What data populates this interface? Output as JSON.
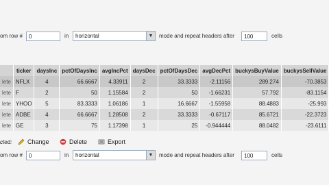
{
  "top_bar": {
    "from_row_label": "om row #",
    "from_row_value": "0",
    "in_label": "in",
    "orientation_value": "horizontal",
    "mode_label": "mode and repeat headers after",
    "repeat_value": "100",
    "cells_label": "cells"
  },
  "table": {
    "columns": [
      "ticker",
      "daysInc",
      "pctOfDaysInc",
      "avgIncPct",
      "daysDec",
      "pctOfDaysDec",
      "avgDecPct",
      "buckysBuyValue",
      "buckysSellValue"
    ],
    "rows": [
      {
        "del": "lete",
        "ticker": "NFLX",
        "daysInc": "4",
        "pctOfDaysInc": "66.6667",
        "avgIncPct": "4.33911",
        "daysDec": "2",
        "pctOfDaysDec": "33.3333",
        "avgDecPct": "-2.11156",
        "buy": "289.274",
        "sell": "-70.3853"
      },
      {
        "del": "lete",
        "ticker": "F",
        "daysInc": "2",
        "pctOfDaysInc": "50",
        "avgIncPct": "1.15584",
        "daysDec": "2",
        "pctOfDaysDec": "50",
        "avgDecPct": "-1.66231",
        "buy": "57.792",
        "sell": "-83.1154"
      },
      {
        "del": "lete",
        "ticker": "YHOO",
        "daysInc": "5",
        "pctOfDaysInc": "83.3333",
        "avgIncPct": "1.06186",
        "daysDec": "1",
        "pctOfDaysDec": "16.6667",
        "avgDecPct": "-1.55958",
        "buy": "88.4883",
        "sell": "-25.993"
      },
      {
        "del": "lete",
        "ticker": "ADBE",
        "daysInc": "4",
        "pctOfDaysInc": "66.6667",
        "avgIncPct": "1.28508",
        "daysDec": "2",
        "pctOfDaysDec": "33.3333",
        "avgDecPct": "-0.67117",
        "buy": "85.6721",
        "sell": "-22.3723"
      },
      {
        "del": "lete",
        "ticker": "GE",
        "daysInc": "3",
        "pctOfDaysInc": "75",
        "avgIncPct": "1.17398",
        "daysDec": "1",
        "pctOfDaysDec": "25",
        "avgDecPct": "-0.944444",
        "buy": "88.0482",
        "sell": "-23.6111"
      }
    ]
  },
  "actions": {
    "prefix": "cted:",
    "change": "Change",
    "delete": "Delete",
    "export": "Export"
  },
  "bottom_bar": {
    "from_row_label": "om row #",
    "from_row_value": "0",
    "in_label": "in",
    "orientation_value": "horizontal",
    "mode_label": "mode and repeat headers after",
    "repeat_value": "100",
    "cells_label": "cells"
  },
  "colors": {
    "header_bg": "#d4d4d4",
    "delete_icon": "#d03a3a",
    "change_icon": "#c8a020"
  }
}
